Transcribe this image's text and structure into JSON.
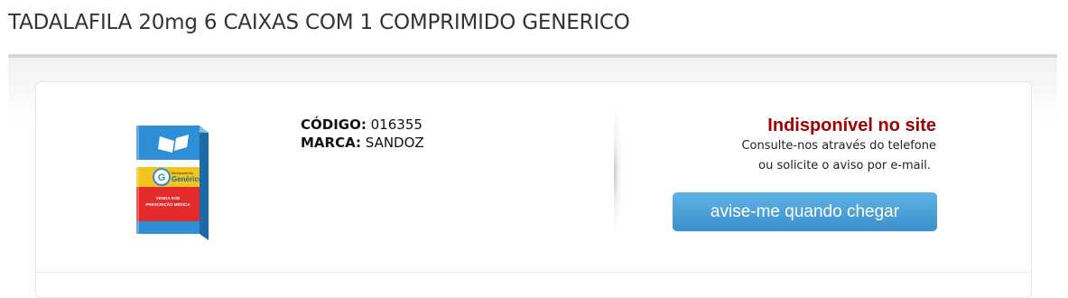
{
  "product": {
    "title": "TADALAFILA 20mg 6 CAIXAS COM 1 COMPRIMIDO GENERICO",
    "code_label": "CÓDIGO:",
    "code_value": "016355",
    "brand_label": "MARCA:",
    "brand_value": "SANDOZ",
    "image": {
      "kind": "generic-medicine-box-icon",
      "brand_text": "Genérico",
      "small_text": "Medicamento",
      "warning_text_1": "VENDA SOB",
      "warning_text_2": "PRESCRIÇÃO MÉDICA"
    }
  },
  "availability": {
    "status": "Indisponível no site",
    "line1": "Consulte-nos através do telefone",
    "line2": "ou solicite o aviso por e-mail.",
    "notify_button": "avise-me quando chegar"
  },
  "colors": {
    "status_red": "#a30000",
    "button_blue": "#4a9fd8",
    "rule_gray": "#d6d6d6"
  }
}
